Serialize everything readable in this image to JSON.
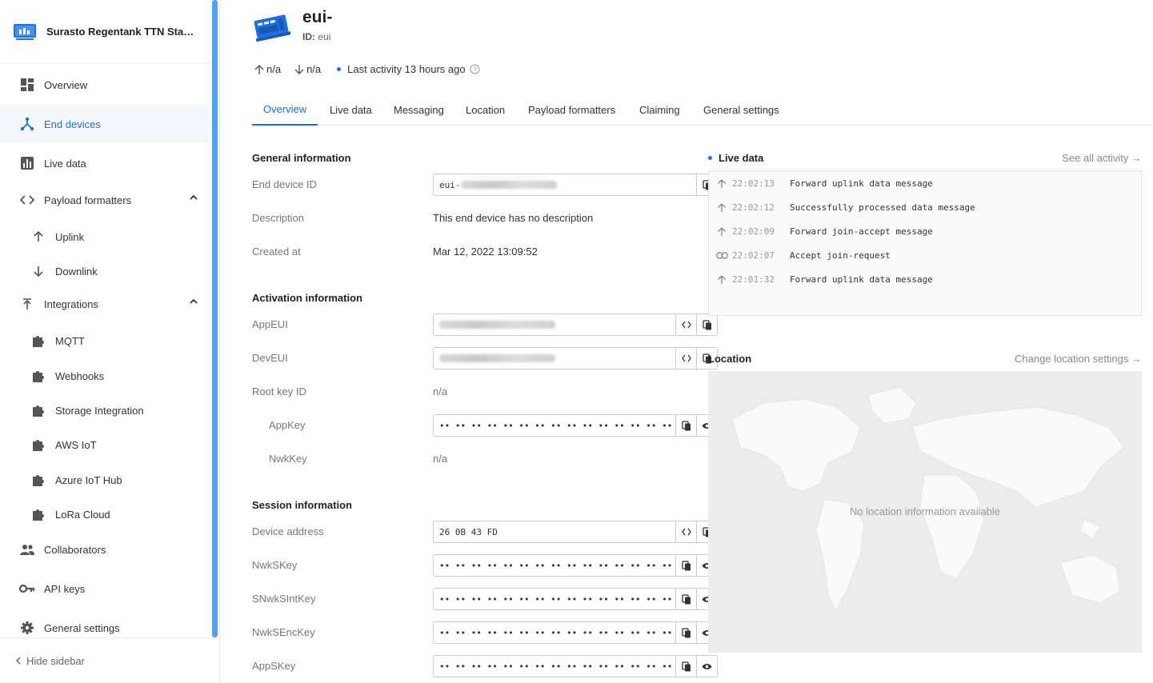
{
  "app": {
    "title": "Surasto Regentank TTN Stac..."
  },
  "sidebar": {
    "items": [
      {
        "label": "Overview"
      },
      {
        "label": "End devices"
      },
      {
        "label": "Live data"
      },
      {
        "label": "Payload formatters"
      },
      {
        "label": "Uplink"
      },
      {
        "label": "Downlink"
      },
      {
        "label": "Integrations"
      },
      {
        "label": "MQTT"
      },
      {
        "label": "Webhooks"
      },
      {
        "label": "Storage Integration"
      },
      {
        "label": "AWS IoT"
      },
      {
        "label": "Azure IoT Hub"
      },
      {
        "label": "LoRa Cloud"
      },
      {
        "label": "Collaborators"
      },
      {
        "label": "API keys"
      },
      {
        "label": "General settings"
      }
    ],
    "hide_label": "Hide sidebar"
  },
  "device": {
    "title": "eui-",
    "id_label": "ID:",
    "id_value": "eui",
    "up": "n/a",
    "down": "n/a",
    "last_activity": "Last activity 13 hours ago"
  },
  "tabs": [
    "Overview",
    "Live data",
    "Messaging",
    "Location",
    "Payload formatters",
    "Claiming",
    "General settings"
  ],
  "general": {
    "title": "General information",
    "end_device_id_label": "End device ID",
    "end_device_id_prefix": "eui-",
    "description_label": "Description",
    "description_value": "This end device has no description",
    "created_label": "Created at",
    "created_value": "Mar 12, 2022 13:09:52"
  },
  "activation": {
    "title": "Activation information",
    "appeui_label": "AppEUI",
    "deveui_label": "DevEUI",
    "rootkey_label": "Root key ID",
    "rootkey_value": "n/a",
    "appkey_label": "AppKey",
    "appkey_value": "•• •• •• •• •• •• •• •• •• •• •• •• •• •• •• ••",
    "nwkkey_label": "NwkKey",
    "nwkkey_value": "n/a"
  },
  "session": {
    "title": "Session information",
    "devaddr_label": "Device address",
    "devaddr_value": "26 0B 43 FD",
    "nwkskey_label": "NwkSKey",
    "snwksintkey_label": "SNwkSIntKey",
    "nwksenckey_label": "NwkSEncKey",
    "appskey_label": "AppSKey",
    "masked": "•• •• •• •• •• •• •• •• •• •• •• •• •• •• •• ••"
  },
  "live": {
    "title": "Live data",
    "link": "See all activity →",
    "events": [
      {
        "time": "22:02:13",
        "msg": "Forward uplink data message",
        "icon": "arrow-up-icon"
      },
      {
        "time": "22:02:12",
        "msg": "Successfully processed data message",
        "icon": "arrow-up-icon"
      },
      {
        "time": "22:02:09",
        "msg": "Forward join-accept message",
        "icon": "arrow-up-icon"
      },
      {
        "time": "22:02:07",
        "msg": "Accept join-request",
        "icon": "link-icon"
      },
      {
        "time": "22:01:32",
        "msg": "Forward uplink data message",
        "icon": "arrow-up-icon"
      }
    ]
  },
  "location": {
    "title": "Location",
    "link": "Change location settings →",
    "empty": "No location information available"
  },
  "colors": {
    "accent": "#1e6fe0",
    "scrollbar": "#4aa3ff"
  }
}
